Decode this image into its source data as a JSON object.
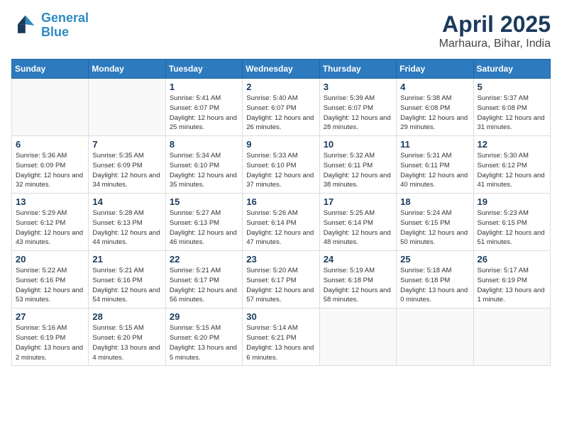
{
  "logo": {
    "line1": "General",
    "line2": "Blue"
  },
  "title": "April 2025",
  "subtitle": "Marhaura, Bihar, India",
  "days_header": [
    "Sunday",
    "Monday",
    "Tuesday",
    "Wednesday",
    "Thursday",
    "Friday",
    "Saturday"
  ],
  "weeks": [
    [
      {
        "day": "",
        "info": ""
      },
      {
        "day": "",
        "info": ""
      },
      {
        "day": "1",
        "info": "Sunrise: 5:41 AM\nSunset: 6:07 PM\nDaylight: 12 hours and 25 minutes."
      },
      {
        "day": "2",
        "info": "Sunrise: 5:40 AM\nSunset: 6:07 PM\nDaylight: 12 hours and 26 minutes."
      },
      {
        "day": "3",
        "info": "Sunrise: 5:39 AM\nSunset: 6:07 PM\nDaylight: 12 hours and 28 minutes."
      },
      {
        "day": "4",
        "info": "Sunrise: 5:38 AM\nSunset: 6:08 PM\nDaylight: 12 hours and 29 minutes."
      },
      {
        "day": "5",
        "info": "Sunrise: 5:37 AM\nSunset: 6:08 PM\nDaylight: 12 hours and 31 minutes."
      }
    ],
    [
      {
        "day": "6",
        "info": "Sunrise: 5:36 AM\nSunset: 6:09 PM\nDaylight: 12 hours and 32 minutes."
      },
      {
        "day": "7",
        "info": "Sunrise: 5:35 AM\nSunset: 6:09 PM\nDaylight: 12 hours and 34 minutes."
      },
      {
        "day": "8",
        "info": "Sunrise: 5:34 AM\nSunset: 6:10 PM\nDaylight: 12 hours and 35 minutes."
      },
      {
        "day": "9",
        "info": "Sunrise: 5:33 AM\nSunset: 6:10 PM\nDaylight: 12 hours and 37 minutes."
      },
      {
        "day": "10",
        "info": "Sunrise: 5:32 AM\nSunset: 6:11 PM\nDaylight: 12 hours and 38 minutes."
      },
      {
        "day": "11",
        "info": "Sunrise: 5:31 AM\nSunset: 6:11 PM\nDaylight: 12 hours and 40 minutes."
      },
      {
        "day": "12",
        "info": "Sunrise: 5:30 AM\nSunset: 6:12 PM\nDaylight: 12 hours and 41 minutes."
      }
    ],
    [
      {
        "day": "13",
        "info": "Sunrise: 5:29 AM\nSunset: 6:12 PM\nDaylight: 12 hours and 43 minutes."
      },
      {
        "day": "14",
        "info": "Sunrise: 5:28 AM\nSunset: 6:13 PM\nDaylight: 12 hours and 44 minutes."
      },
      {
        "day": "15",
        "info": "Sunrise: 5:27 AM\nSunset: 6:13 PM\nDaylight: 12 hours and 46 minutes."
      },
      {
        "day": "16",
        "info": "Sunrise: 5:26 AM\nSunset: 6:14 PM\nDaylight: 12 hours and 47 minutes."
      },
      {
        "day": "17",
        "info": "Sunrise: 5:25 AM\nSunset: 6:14 PM\nDaylight: 12 hours and 48 minutes."
      },
      {
        "day": "18",
        "info": "Sunrise: 5:24 AM\nSunset: 6:15 PM\nDaylight: 12 hours and 50 minutes."
      },
      {
        "day": "19",
        "info": "Sunrise: 5:23 AM\nSunset: 6:15 PM\nDaylight: 12 hours and 51 minutes."
      }
    ],
    [
      {
        "day": "20",
        "info": "Sunrise: 5:22 AM\nSunset: 6:16 PM\nDaylight: 12 hours and 53 minutes."
      },
      {
        "day": "21",
        "info": "Sunrise: 5:21 AM\nSunset: 6:16 PM\nDaylight: 12 hours and 54 minutes."
      },
      {
        "day": "22",
        "info": "Sunrise: 5:21 AM\nSunset: 6:17 PM\nDaylight: 12 hours and 56 minutes."
      },
      {
        "day": "23",
        "info": "Sunrise: 5:20 AM\nSunset: 6:17 PM\nDaylight: 12 hours and 57 minutes."
      },
      {
        "day": "24",
        "info": "Sunrise: 5:19 AM\nSunset: 6:18 PM\nDaylight: 12 hours and 58 minutes."
      },
      {
        "day": "25",
        "info": "Sunrise: 5:18 AM\nSunset: 6:18 PM\nDaylight: 13 hours and 0 minutes."
      },
      {
        "day": "26",
        "info": "Sunrise: 5:17 AM\nSunset: 6:19 PM\nDaylight: 13 hours and 1 minute."
      }
    ],
    [
      {
        "day": "27",
        "info": "Sunrise: 5:16 AM\nSunset: 6:19 PM\nDaylight: 13 hours and 2 minutes."
      },
      {
        "day": "28",
        "info": "Sunrise: 5:15 AM\nSunset: 6:20 PM\nDaylight: 13 hours and 4 minutes."
      },
      {
        "day": "29",
        "info": "Sunrise: 5:15 AM\nSunset: 6:20 PM\nDaylight: 13 hours and 5 minutes."
      },
      {
        "day": "30",
        "info": "Sunrise: 5:14 AM\nSunset: 6:21 PM\nDaylight: 13 hours and 6 minutes."
      },
      {
        "day": "",
        "info": ""
      },
      {
        "day": "",
        "info": ""
      },
      {
        "day": "",
        "info": ""
      }
    ]
  ]
}
